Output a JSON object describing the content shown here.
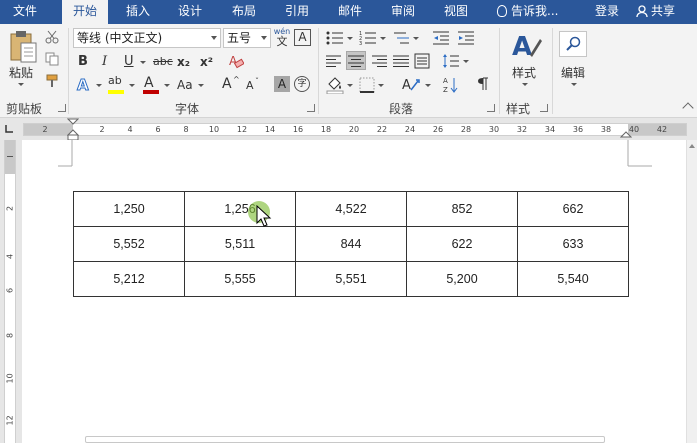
{
  "tabs": [
    {
      "label": "文件",
      "active": false
    },
    {
      "label": "开始",
      "active": true
    },
    {
      "label": "插入",
      "active": false
    },
    {
      "label": "设计",
      "active": false
    },
    {
      "label": "布局",
      "active": false
    },
    {
      "label": "引用",
      "active": false
    },
    {
      "label": "邮件",
      "active": false
    },
    {
      "label": "审阅",
      "active": false
    },
    {
      "label": "视图",
      "active": false
    }
  ],
  "tell_me": "告诉我...",
  "login": "登录",
  "share": "共享",
  "ribbon": {
    "clipboard": {
      "paste_label": "粘贴",
      "group_label": "剪贴板"
    },
    "font": {
      "font_name": "等线 (中文正文)",
      "font_size": "五号",
      "group_label": "字体",
      "bold": "B",
      "italic": "I",
      "underline": "U",
      "strike": "abc",
      "subscript": "x₂",
      "superscript": "x²",
      "grow": "A",
      "shrink": "A",
      "case": "Aa",
      "wen_label": "wén",
      "wen_char": "文",
      "char_border": "A",
      "char_shade": "A",
      "enclose": "字",
      "phonetic": "A"
    },
    "paragraph": {
      "group_label": "段落"
    },
    "styles": {
      "label": "样式",
      "group_label": "样式"
    },
    "editing": {
      "label": "编辑"
    }
  },
  "ruler_numbers": [
    "2",
    "2",
    "4",
    "6",
    "8",
    "10",
    "12",
    "14",
    "16",
    "18",
    "20",
    "22",
    "24",
    "26",
    "28",
    "30",
    "32",
    "34",
    "36",
    "38",
    "40",
    "42"
  ],
  "vruler_numbers": [
    "2",
    "4",
    "6",
    "8",
    "10",
    "12"
  ],
  "table": {
    "rows": [
      [
        "1,250",
        "1,256",
        "4,522",
        "852",
        "662"
      ],
      [
        "5,552",
        "5,511",
        "844",
        "622",
        "633"
      ],
      [
        "5,212",
        "5,555",
        "5,551",
        "5,200",
        "5,540"
      ]
    ]
  },
  "colors": {
    "title_bar": "#2b579a",
    "ribbon_bg": "#f3f3f3",
    "highlight_yellow": "#ffff00",
    "font_red": "#c00000",
    "cursor_highlight": "#82be3c"
  }
}
